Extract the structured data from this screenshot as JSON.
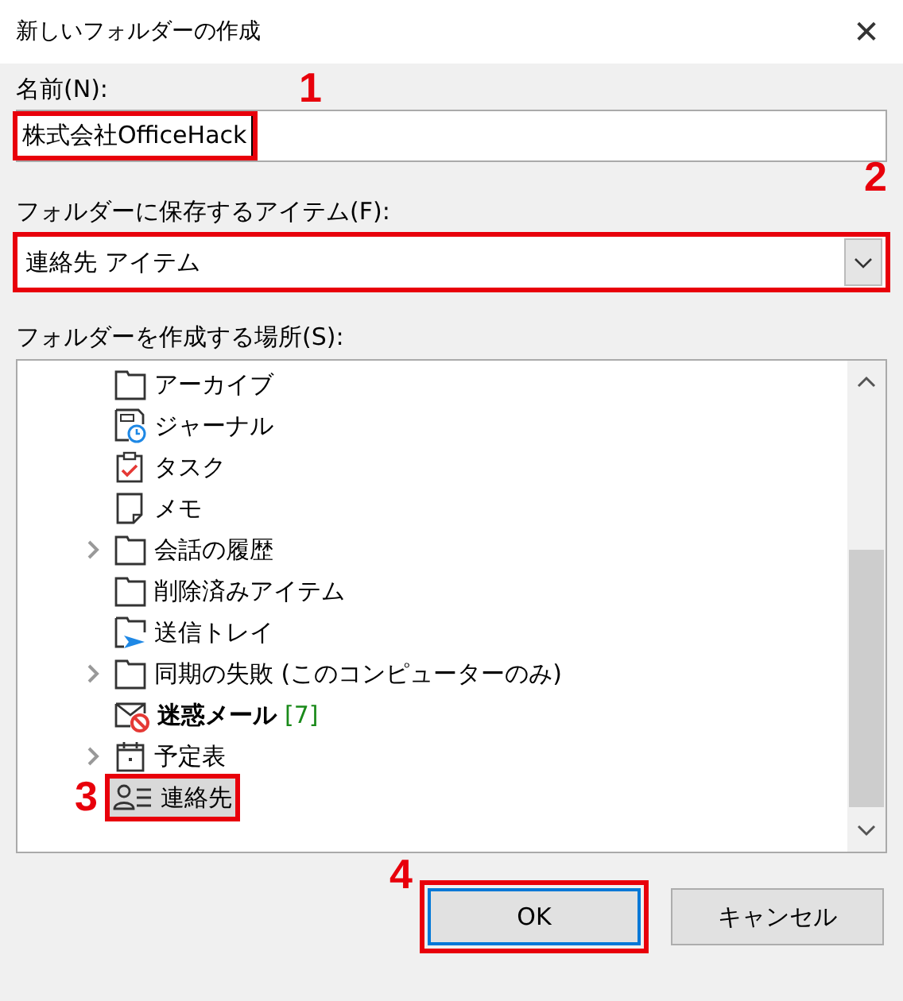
{
  "window": {
    "title": "新しいフォルダーの作成",
    "close": "✕"
  },
  "name_field": {
    "label": "名前(N):",
    "value": "株式会社OfficeHack",
    "callout": "1"
  },
  "item_type": {
    "label": "フォルダーに保存するアイテム(F):",
    "value": "連絡先 アイテム",
    "callout": "2"
  },
  "location": {
    "label": "フォルダーを作成する場所(S):",
    "items": [
      {
        "label": "アーカイブ",
        "kind": "folder",
        "expandable": false,
        "bold": false,
        "selected": false
      },
      {
        "label": "ジャーナル",
        "kind": "journal",
        "expandable": false,
        "bold": false,
        "selected": false
      },
      {
        "label": "タスク",
        "kind": "task",
        "expandable": false,
        "bold": false,
        "selected": false
      },
      {
        "label": "メモ",
        "kind": "note",
        "expandable": false,
        "bold": false,
        "selected": false
      },
      {
        "label": "会話の履歴",
        "kind": "folder",
        "expandable": true,
        "bold": false,
        "selected": false
      },
      {
        "label": "削除済みアイテム",
        "kind": "folder",
        "expandable": false,
        "bold": false,
        "selected": false
      },
      {
        "label": "送信トレイ",
        "kind": "outbox",
        "expandable": false,
        "bold": false,
        "selected": false
      },
      {
        "label": "同期の失敗 (このコンピューターのみ)",
        "kind": "folder",
        "expandable": true,
        "bold": false,
        "selected": false
      },
      {
        "label": "迷惑メール",
        "kind": "junk",
        "expandable": false,
        "bold": true,
        "count": "[7]",
        "selected": false
      },
      {
        "label": "予定表",
        "kind": "calendar",
        "expandable": true,
        "bold": false,
        "selected": false
      },
      {
        "label": "連絡先",
        "kind": "contacts",
        "expandable": false,
        "bold": false,
        "selected": true,
        "callout": "3"
      }
    ]
  },
  "buttons": [
    {
      "label": "OK",
      "default": true,
      "callout": "4"
    },
    {
      "label": "キャンセル",
      "default": false
    }
  ]
}
